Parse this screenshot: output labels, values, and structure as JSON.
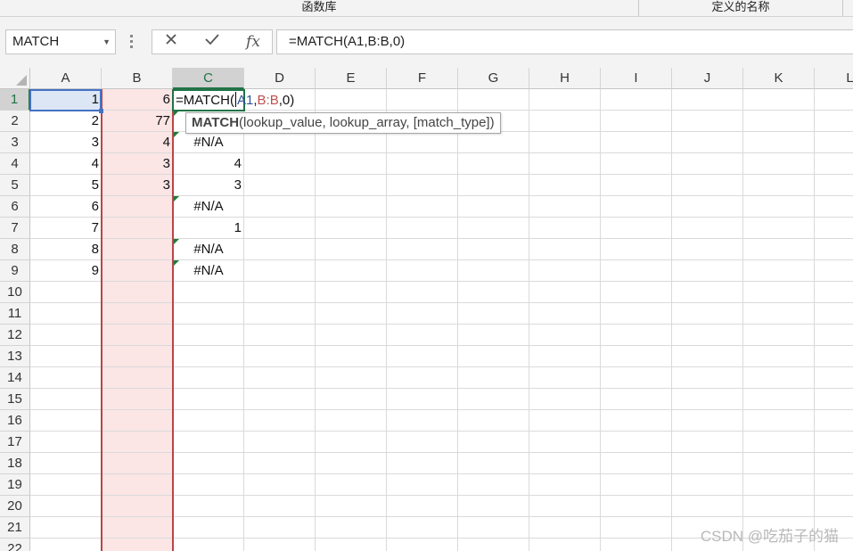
{
  "ribbon": {
    "group_function_library": "函数库",
    "group_defined_names": "定义的名称"
  },
  "formula_bar": {
    "name_box": "MATCH",
    "cancel_icon": "x-icon",
    "enter_icon": "check-icon",
    "fx_label": "fx",
    "content": "=MATCH(A1,B:B,0)"
  },
  "columns": [
    "A",
    "B",
    "C",
    "D",
    "E",
    "F",
    "G",
    "H",
    "I",
    "J",
    "K",
    "L"
  ],
  "selected_column": "C",
  "rows": [
    "1",
    "2",
    "3",
    "4",
    "5",
    "6",
    "7",
    "8",
    "9",
    "10",
    "11",
    "12",
    "13",
    "14",
    "15",
    "16",
    "17",
    "18",
    "19",
    "20",
    "21",
    "22"
  ],
  "selected_row": "1",
  "cells": {
    "A": [
      "1",
      "2",
      "3",
      "4",
      "5",
      "6",
      "7",
      "8",
      "9"
    ],
    "B": [
      "6",
      "77",
      "4",
      "3",
      "3"
    ],
    "C": [
      "",
      "",
      "#N/A",
      "4",
      "3",
      "#N/A",
      "1",
      "#N/A",
      "#N/A"
    ]
  },
  "editing_cell": {
    "prefix": "=MATCH(",
    "arg1": "A1",
    "sep1": ",",
    "arg2": "B:B",
    "suffix": ",0)"
  },
  "tooltip": {
    "function_name": "MATCH",
    "signature": "(lookup_value, lookup_array, [match_type])"
  },
  "watermark": "CSDN @吃茄子的猫",
  "colors": {
    "accent_green": "#217346",
    "selection_blue": "#4472c4",
    "ref_blue": "#2f5597",
    "ref_red": "#c0504d",
    "column_b_fill": "#fbe5e5"
  }
}
